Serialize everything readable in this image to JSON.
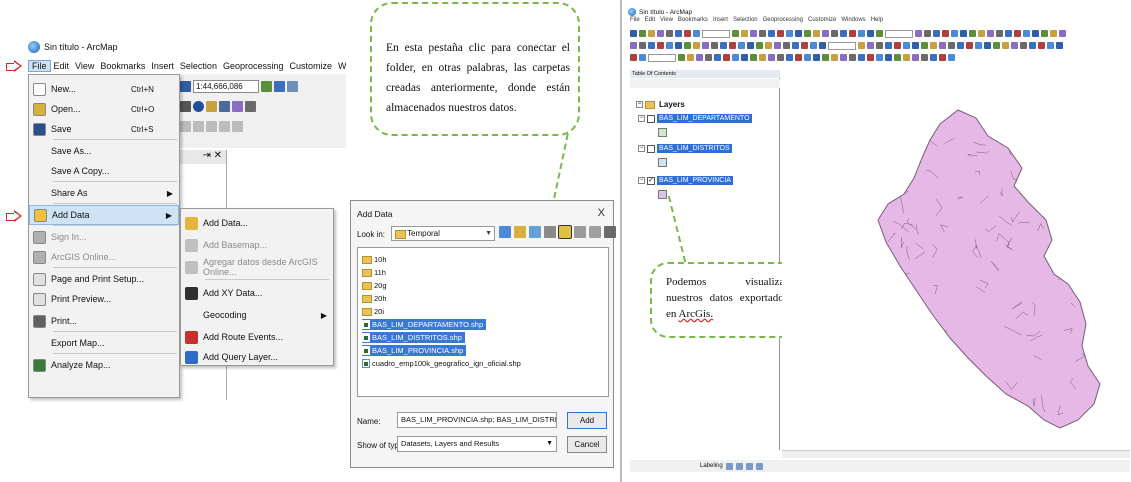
{
  "left": {
    "window_title": "Sin título - ArcMap",
    "menubar": [
      "File",
      "Edit",
      "View",
      "Bookmarks",
      "Insert",
      "Selection",
      "Geoprocessing",
      "Customize",
      "Windows"
    ],
    "scale_value": "1:44,666,086",
    "file_menu": [
      {
        "label": "New...",
        "shortcut": "Ctrl+N",
        "disabled": false
      },
      {
        "label": "Open...",
        "shortcut": "Ctrl+O",
        "disabled": false
      },
      {
        "label": "Save",
        "shortcut": "Ctrl+S",
        "disabled": false
      },
      {
        "label": "Save As...",
        "shortcut": "",
        "disabled": false
      },
      {
        "label": "Save A Copy...",
        "shortcut": "",
        "disabled": false
      },
      {
        "label": "Share As",
        "shortcut": "",
        "disabled": false
      },
      {
        "label": "Add Data",
        "shortcut": "",
        "disabled": false
      },
      {
        "label": "Sign In...",
        "shortcut": "",
        "disabled": true
      },
      {
        "label": "ArcGIS Online...",
        "shortcut": "",
        "disabled": true
      },
      {
        "label": "Page and Print Setup...",
        "shortcut": "",
        "disabled": false
      },
      {
        "label": "Print Preview...",
        "shortcut": "",
        "disabled": false
      },
      {
        "label": "Print...",
        "shortcut": "",
        "disabled": false
      },
      {
        "label": "Export Map...",
        "shortcut": "",
        "disabled": false
      },
      {
        "label": "Analyze Map...",
        "shortcut": "",
        "disabled": false
      }
    ],
    "add_data_submenu": [
      {
        "label": "Add Data...",
        "disabled": false
      },
      {
        "label": "Add Basemap...",
        "disabled": true
      },
      {
        "label": "Agregar datos desde ArcGIS Online...",
        "disabled": true
      },
      {
        "label": "Add XY Data...",
        "disabled": false
      },
      {
        "label": "Geocoding",
        "disabled": false
      },
      {
        "label": "Add Route Events...",
        "disabled": false
      },
      {
        "label": "Add Query Layer...",
        "disabled": false
      }
    ]
  },
  "middle": {
    "callout_text": "En esta pestaña clic para conectar el folder, en otras palabras, las carpetas creadas anteriormente, donde están almacenados nuestros datos.",
    "dialog": {
      "title": "Add Data",
      "close": "X",
      "look_in_label": "Look in:",
      "look_in_value": "Temporal",
      "files": [
        {
          "name": "10h",
          "kind": "folder",
          "selected": false
        },
        {
          "name": "11h",
          "kind": "folder",
          "selected": false
        },
        {
          "name": "20g",
          "kind": "folder",
          "selected": false
        },
        {
          "name": "20h",
          "kind": "folder",
          "selected": false
        },
        {
          "name": "20i",
          "kind": "folder",
          "selected": false
        },
        {
          "name": "BAS_LIM_DEPARTAMENTO.shp",
          "kind": "shp",
          "selected": true
        },
        {
          "name": "BAS_LIM_DISTRITOS.shp",
          "kind": "shp",
          "selected": true
        },
        {
          "name": "BAS_LIM_PROVINCIA.shp",
          "kind": "shp",
          "selected": true
        },
        {
          "name": "cuadro_emp100k_geografico_ign_oficial.shp",
          "kind": "shp",
          "selected": false
        }
      ],
      "name_label": "Name:",
      "name_value": "BAS_LIM_PROVINCIA.shp; BAS_LIM_DISTRITOS.shp; BAS",
      "type_label": "Show of type:",
      "type_value": "Datasets, Layers and Results",
      "add_button": "Add",
      "cancel_button": "Cancel"
    }
  },
  "right": {
    "window_title": "Sin título - ArcMap",
    "menubar": [
      "File",
      "Edit",
      "View",
      "Bookmarks",
      "Insert",
      "Selection",
      "Geoprocessing",
      "Customize",
      "Windows",
      "Help"
    ],
    "toc_title": "Table Of Contents",
    "layers_root": "Layers",
    "layers": [
      {
        "name": "BAS_LIM_DEPARTAMENTO",
        "checked": false,
        "color": "#cfe8c8"
      },
      {
        "name": "BAS_LIM_DISTRITOS",
        "checked": false,
        "color": "#cde3f2"
      },
      {
        "name": "BAS_LIM_PROVINCIA",
        "checked": true,
        "color": "#dcc2e3"
      }
    ],
    "callout_text_plain": "Podemos visualizar nuestros datos exportados en",
    "callout_text_underlined": "ArcGis.",
    "map_fill_color": "#e5b8e6",
    "map_stroke_color": "#7b5a7d",
    "status_text": "Labeling"
  }
}
